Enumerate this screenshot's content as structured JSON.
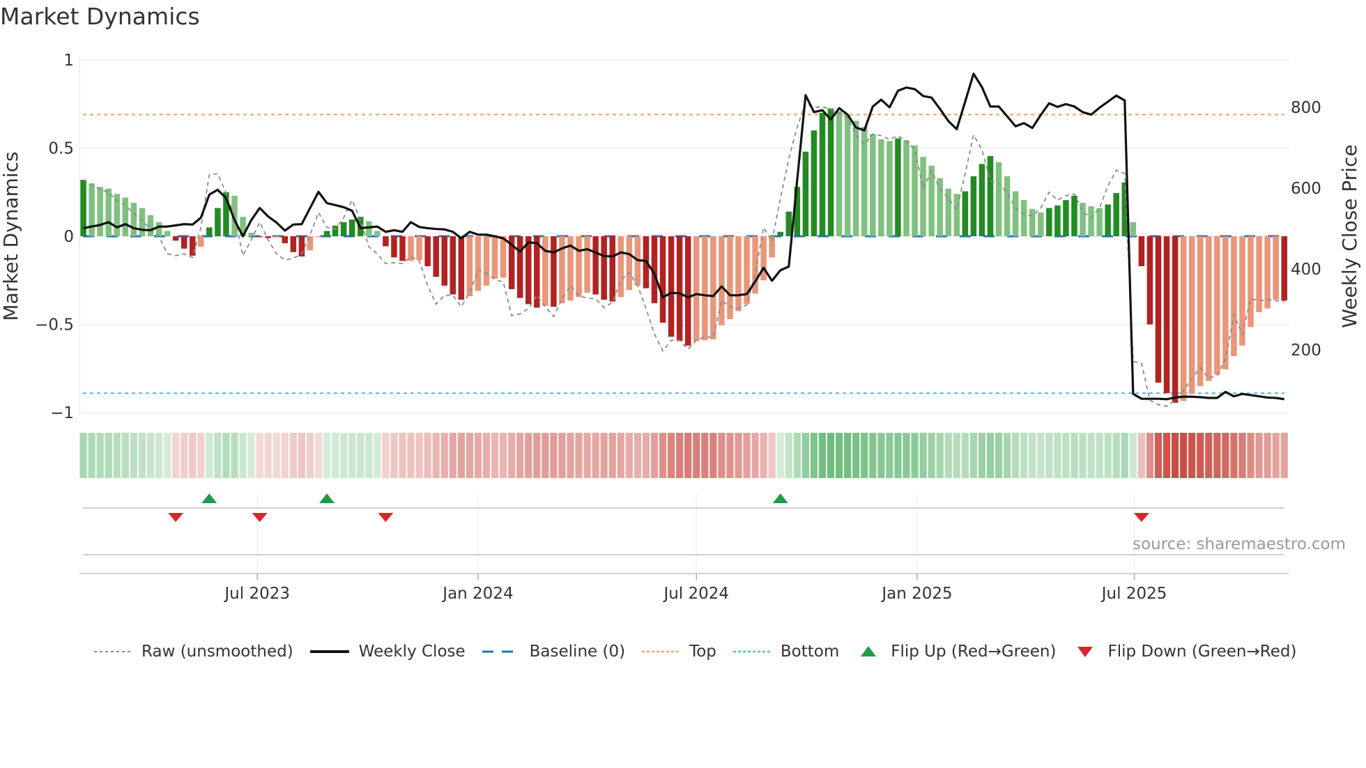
{
  "title": "Market Dynamics",
  "source": "source: sharemaestro.com",
  "legend": {
    "raw": "Raw (unsmoothed)",
    "close": "Weekly Close",
    "baseline": "Baseline (0)",
    "top": "Top",
    "bottom": "Bottom",
    "flip_up": "Flip Up (Red→Green)",
    "flip_down": "Flip Down (Green→Red)"
  },
  "colors": {
    "strong_up": "#228b22",
    "weak_up": "#80c080",
    "strong_down": "#b22222",
    "weak_down": "#e9967a",
    "close": "#111111",
    "raw": "#8a8a8a",
    "baseline": "#1f77b4",
    "top": "#f4a460",
    "bottom": "#3cc8d8",
    "flip_up": "#1a9e46",
    "flip_down": "#d62728"
  },
  "chart_data": {
    "type": "bar",
    "title": "Market Dynamics",
    "ylabel": "Market Dynamics",
    "y2label": "Weekly Close Price",
    "ylim": [
      -1,
      1
    ],
    "y2lim": [
      45,
      917
    ],
    "yticks": [
      "1",
      "0.5",
      "0",
      "−0.5",
      "−1"
    ],
    "ytick_values": [
      1,
      0.5,
      0,
      -0.5,
      -1
    ],
    "y2ticks": [
      "200",
      "400",
      "600",
      "800"
    ],
    "y2tick_values": [
      200,
      400,
      600,
      800
    ],
    "x_start": "2023-02-06",
    "x_frequency": "weekly",
    "xticks": [
      {
        "label": "Jul 2023",
        "date": "2023-07-01"
      },
      {
        "label": "Jan 2024",
        "date": "2024-01-01"
      },
      {
        "label": "Jul 2024",
        "date": "2024-07-01"
      },
      {
        "label": "Jan 2025",
        "date": "2025-01-01"
      },
      {
        "label": "Jul 2025",
        "date": "2025-07-01"
      }
    ],
    "top_level": 0.69,
    "bottom_level": -0.89,
    "baseline": 0,
    "momentum": [
      0.32,
      0.3,
      0.28,
      0.27,
      0.24,
      0.22,
      0.19,
      0.16,
      0.12,
      0.08,
      0.03,
      -0.025,
      -0.07,
      -0.11,
      -0.06,
      0.05,
      0.16,
      0.25,
      0.23,
      0.11,
      0.02,
      -0.005,
      -0.01,
      -0.005,
      -0.04,
      -0.09,
      -0.115,
      -0.08,
      -0.005,
      0.03,
      0.06,
      0.08,
      0.095,
      0.11,
      0.085,
      0.03,
      -0.057,
      -0.12,
      -0.14,
      -0.14,
      -0.135,
      -0.17,
      -0.23,
      -0.28,
      -0.33,
      -0.36,
      -0.34,
      -0.31,
      -0.28,
      -0.24,
      -0.235,
      -0.3,
      -0.35,
      -0.385,
      -0.405,
      -0.395,
      -0.4,
      -0.38,
      -0.365,
      -0.345,
      -0.32,
      -0.33,
      -0.36,
      -0.37,
      -0.345,
      -0.305,
      -0.28,
      -0.295,
      -0.38,
      -0.49,
      -0.57,
      -0.595,
      -0.62,
      -0.595,
      -0.59,
      -0.585,
      -0.505,
      -0.47,
      -0.425,
      -0.385,
      -0.325,
      -0.25,
      -0.12,
      0.025,
      0.14,
      0.28,
      0.48,
      0.6,
      0.7,
      0.725,
      0.71,
      0.69,
      0.655,
      0.62,
      0.58,
      0.55,
      0.54,
      0.555,
      0.545,
      0.515,
      0.45,
      0.4,
      0.33,
      0.27,
      0.24,
      0.255,
      0.34,
      0.41,
      0.455,
      0.42,
      0.34,
      0.255,
      0.205,
      0.155,
      0.135,
      0.16,
      0.175,
      0.205,
      0.23,
      0.19,
      0.17,
      0.16,
      0.18,
      0.245,
      0.305,
      0.08,
      -0.17,
      -0.5,
      -0.83,
      -0.89,
      -0.945,
      -0.935,
      -0.895,
      -0.85,
      -0.82,
      -0.785,
      -0.755,
      -0.68,
      -0.62,
      -0.515,
      -0.43,
      -0.41,
      -0.36,
      -0.365
    ],
    "strengthening": [
      1,
      0,
      0,
      0,
      0,
      0,
      0,
      0,
      0,
      0,
      0,
      1,
      1,
      1,
      0,
      1,
      1,
      1,
      0,
      0,
      0,
      1,
      1,
      0,
      1,
      1,
      1,
      0,
      0,
      1,
      1,
      1,
      1,
      1,
      0,
      0,
      1,
      1,
      1,
      0,
      0,
      1,
      1,
      1,
      1,
      1,
      0,
      0,
      0,
      0,
      0,
      1,
      1,
      1,
      1,
      0,
      1,
      0,
      0,
      0,
      0,
      1,
      1,
      1,
      0,
      0,
      0,
      1,
      1,
      1,
      1,
      1,
      1,
      0,
      0,
      0,
      0,
      0,
      0,
      0,
      0,
      0,
      0,
      1,
      1,
      1,
      1,
      1,
      1,
      1,
      0,
      0,
      0,
      0,
      0,
      0,
      0,
      1,
      0,
      0,
      0,
      0,
      0,
      0,
      0,
      1,
      1,
      1,
      1,
      0,
      0,
      0,
      0,
      0,
      0,
      1,
      1,
      1,
      1,
      0,
      0,
      0,
      1,
      1,
      1,
      0,
      1,
      1,
      1,
      1,
      1,
      0,
      0,
      0,
      0,
      0,
      0,
      0,
      0,
      0,
      0,
      0,
      0,
      1
    ],
    "raw": [
      0.32,
      0.29,
      0.265,
      0.25,
      0.2,
      0.175,
      0.13,
      0.09,
      0.04,
      0,
      -0.1,
      -0.11,
      -0.1,
      -0.12,
      0.05,
      0.35,
      0.355,
      0.245,
      0.11,
      -0.11,
      -0.02,
      0.08,
      -0.02,
      -0.1,
      -0.135,
      -0.125,
      -0.1,
      0.01,
      0.135,
      0.05,
      0.04,
      0.105,
      0.205,
      0.09,
      -0.06,
      -0.1,
      -0.155,
      -0.15,
      -0.155,
      -0.115,
      -0.14,
      -0.28,
      -0.385,
      -0.335,
      -0.335,
      -0.4,
      -0.32,
      -0.19,
      -0.21,
      -0.245,
      -0.26,
      -0.45,
      -0.44,
      -0.41,
      -0.335,
      -0.4,
      -0.455,
      -0.355,
      -0.28,
      -0.34,
      -0.35,
      -0.355,
      -0.405,
      -0.375,
      -0.25,
      -0.205,
      -0.28,
      -0.41,
      -0.555,
      -0.65,
      -0.59,
      -0.59,
      -0.64,
      -0.59,
      -0.57,
      -0.575,
      -0.365,
      -0.4,
      -0.41,
      -0.39,
      -0.21,
      0.05,
      -0.03,
      0.215,
      0.44,
      0.62,
      0.755,
      0.73,
      0.735,
      0.72,
      0.7,
      0.67,
      0.575,
      0.52,
      0.58,
      0.57,
      0.55,
      0.57,
      0.54,
      0.49,
      0.27,
      0.37,
      0.27,
      0.215,
      0.15,
      0.355,
      0.575,
      0.49,
      0.315,
      0.3,
      0.245,
      0.16,
      0.125,
      0.115,
      0.16,
      0.25,
      0.205,
      0.23,
      0.24,
      0.14,
      0.105,
      0.16,
      0.285,
      0.375,
      0.355,
      -0.71,
      -0.72,
      -0.93,
      -0.955,
      -0.965,
      -0.93,
      -0.875,
      -0.805,
      -0.745,
      -0.805,
      -0.79,
      -0.695,
      -0.445,
      -0.555,
      -0.355,
      -0.365,
      -0.36,
      -0.365,
      -0.37
    ],
    "close": [
      501,
      505,
      509,
      516,
      503,
      511,
      501,
      497,
      496,
      505,
      505,
      508,
      511,
      510,
      527,
      584,
      596,
      575,
      521,
      481,
      521,
      551,
      530,
      515,
      495,
      510,
      511,
      551,
      591,
      563,
      558,
      553,
      544,
      501,
      503,
      505,
      492,
      496,
      492,
      516,
      504,
      501,
      499,
      498,
      492,
      476,
      492,
      485,
      485,
      481,
      476,
      460,
      443,
      466,
      464,
      445,
      441,
      451,
      458,
      445,
      449,
      441,
      432,
      431,
      441,
      437,
      422,
      420,
      388,
      330,
      341,
      340,
      330,
      338,
      335,
      333,
      357,
      335,
      335,
      338,
      369,
      403,
      371,
      397,
      406,
      620,
      830,
      788,
      793,
      770,
      798,
      782,
      750,
      743,
      802,
      819,
      800,
      841,
      849,
      845,
      828,
      824,
      796,
      766,
      746,
      814,
      883,
      850,
      802,
      802,
      778,
      753,
      761,
      749,
      781,
      810,
      801,
      808,
      802,
      788,
      782,
      799,
      814,
      829,
      817,
      91,
      79,
      79,
      79,
      78,
      82,
      84,
      84,
      83,
      81,
      81,
      96,
      85,
      91,
      88,
      85,
      82,
      81,
      78
    ],
    "flip_up_weeks": [
      15,
      29,
      83
    ],
    "flip_down_weeks": [
      11,
      21,
      36,
      126
    ],
    "legend_position": "bottom"
  }
}
